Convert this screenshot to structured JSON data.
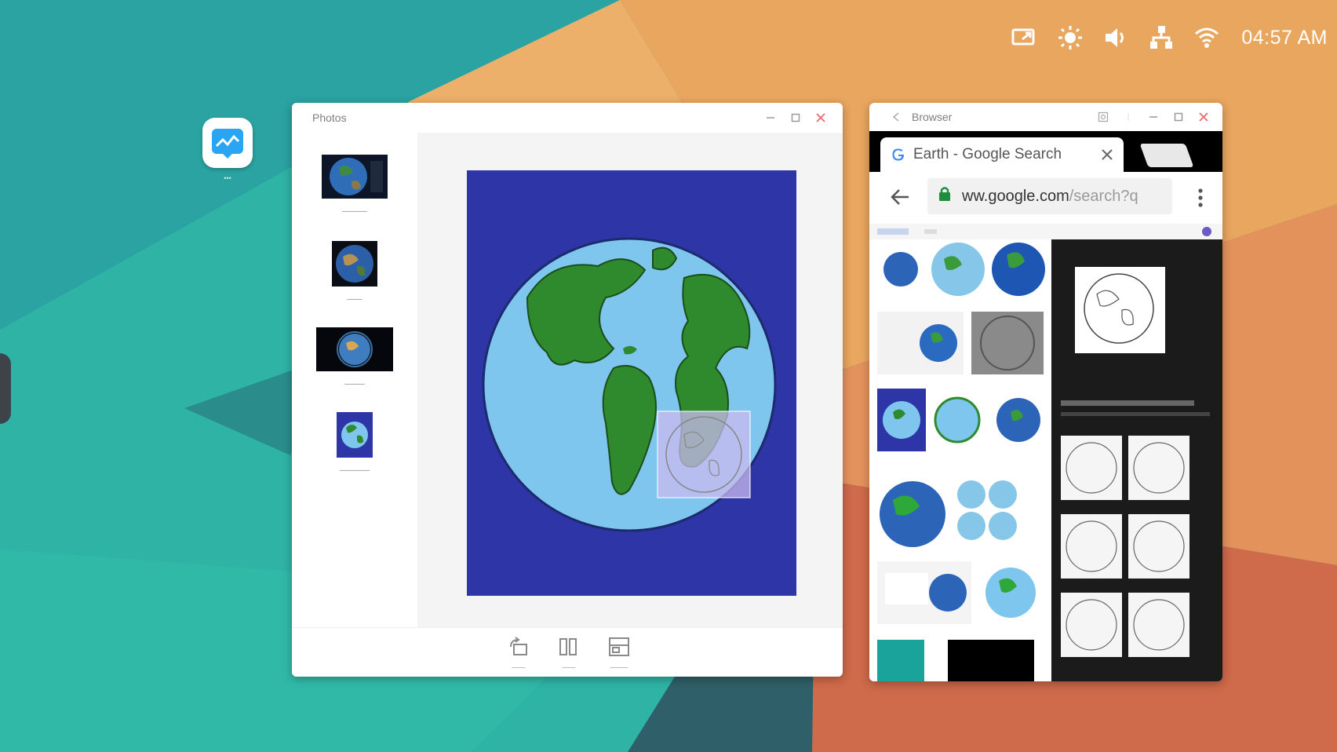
{
  "colors": {
    "wallpaper_teal": "#2fb3a5",
    "wallpaper_orange": "#e9a65f",
    "wallpaper_rust": "#cf6a4a",
    "photo_background": "#2e35a6",
    "ocean": "#7fc6ee",
    "land": "#2f8a2d",
    "window_close": "#e96c6c",
    "app_icon_blue": "#2aa5f3"
  },
  "status_bar": {
    "icons": [
      "screen-share-icon",
      "brightness-icon",
      "volume-icon",
      "network-icon",
      "wifi-icon"
    ],
    "clock": "04:57 AM"
  },
  "desktop": {
    "app_icon": "image-editor-icon"
  },
  "photos_window": {
    "title": "Photos",
    "selected_index": 3,
    "thumbnails": [
      {
        "icon": "earth-photo-thumbnail"
      },
      {
        "icon": "earth-photo-thumbnail"
      },
      {
        "icon": "earth-photo-thumbnail"
      },
      {
        "icon": "earth-drawing-thumbnail"
      }
    ],
    "bottom_actions": [
      {
        "icon": "rotate-icon"
      },
      {
        "icon": "insert-icon"
      },
      {
        "icon": "wallpaper-icon"
      }
    ]
  },
  "browser_window": {
    "title": "Browser",
    "tab_title": "Earth - Google Search",
    "url_host": "ww.google.com",
    "url_path": "/search?q"
  }
}
